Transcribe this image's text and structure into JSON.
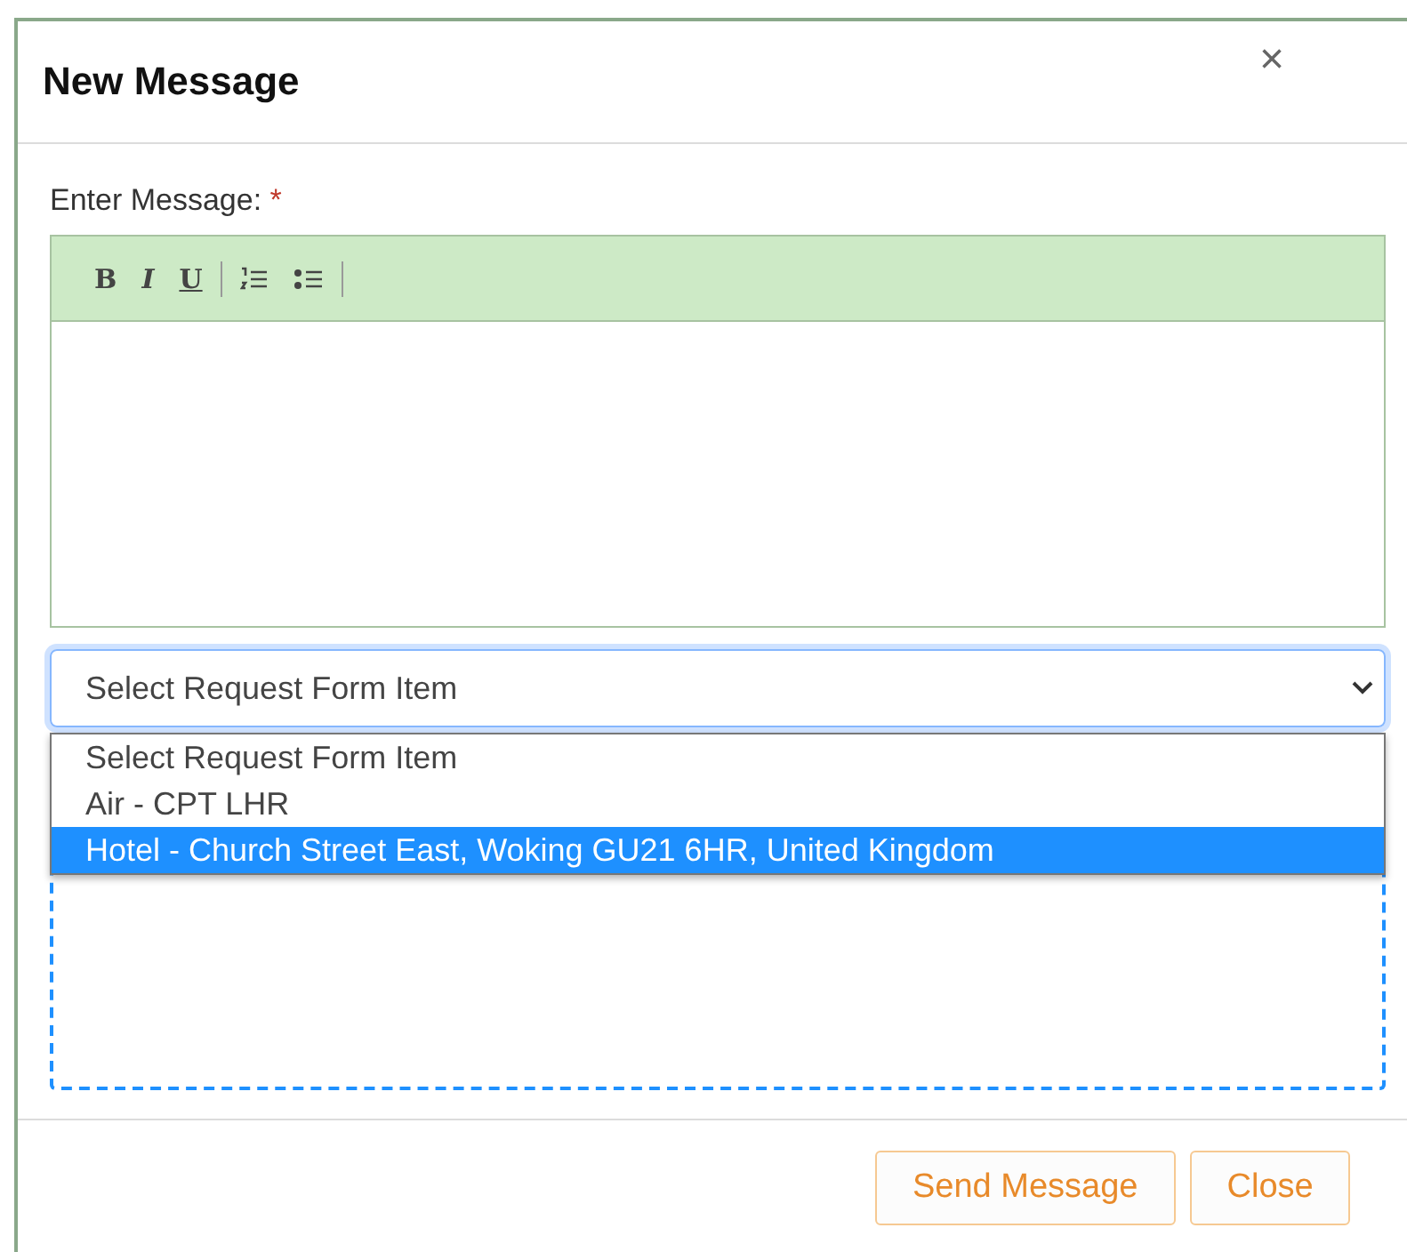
{
  "dialog": {
    "title": "New Message",
    "close_glyph": "×"
  },
  "message": {
    "label": "Enter Message:",
    "required_mark": "*",
    "toolbar": [
      {
        "kind": "bold",
        "label": "B"
      },
      {
        "kind": "italic",
        "label": "I"
      },
      {
        "kind": "underline",
        "label": "U"
      },
      {
        "kind": "separator"
      },
      {
        "kind": "ordered-list"
      },
      {
        "kind": "bullet-list"
      },
      {
        "kind": "separator"
      }
    ]
  },
  "request_select": {
    "value": "Select Request Form Item",
    "expanded": true,
    "options": [
      {
        "label": "Select Request Form Item",
        "highlighted": false
      },
      {
        "label": "Air - CPT LHR",
        "highlighted": false
      },
      {
        "label": "Hotel - Church Street East, Woking GU21 6HR, United Kingdom",
        "highlighted": true
      }
    ]
  },
  "buttons": [
    {
      "label": "Send Message"
    },
    {
      "label": "Close"
    }
  ]
}
